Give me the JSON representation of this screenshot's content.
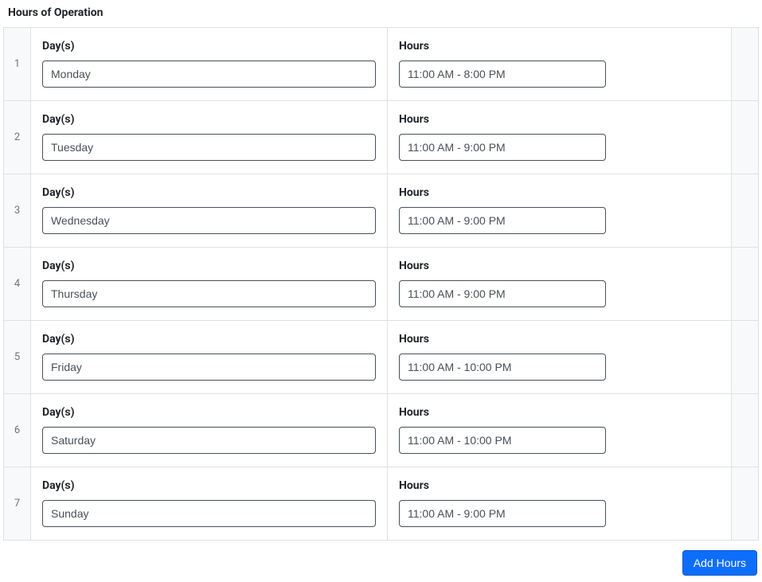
{
  "section_title": "Hours of Operation",
  "labels": {
    "days": "Day(s)",
    "hours": "Hours"
  },
  "add_button": "Add Hours",
  "rows": [
    {
      "num": "1",
      "day": "Monday",
      "hours": "11:00 AM - 8:00 PM"
    },
    {
      "num": "2",
      "day": "Tuesday",
      "hours": "11:00 AM - 9:00 PM"
    },
    {
      "num": "3",
      "day": "Wednesday",
      "hours": "11:00 AM - 9:00 PM"
    },
    {
      "num": "4",
      "day": "Thursday",
      "hours": "11:00 AM - 9:00 PM"
    },
    {
      "num": "5",
      "day": "Friday",
      "hours": "11:00 AM - 10:00 PM"
    },
    {
      "num": "6",
      "day": "Saturday",
      "hours": "11:00 AM - 10:00 PM"
    },
    {
      "num": "7",
      "day": "Sunday",
      "hours": "11:00 AM - 9:00 PM"
    }
  ]
}
